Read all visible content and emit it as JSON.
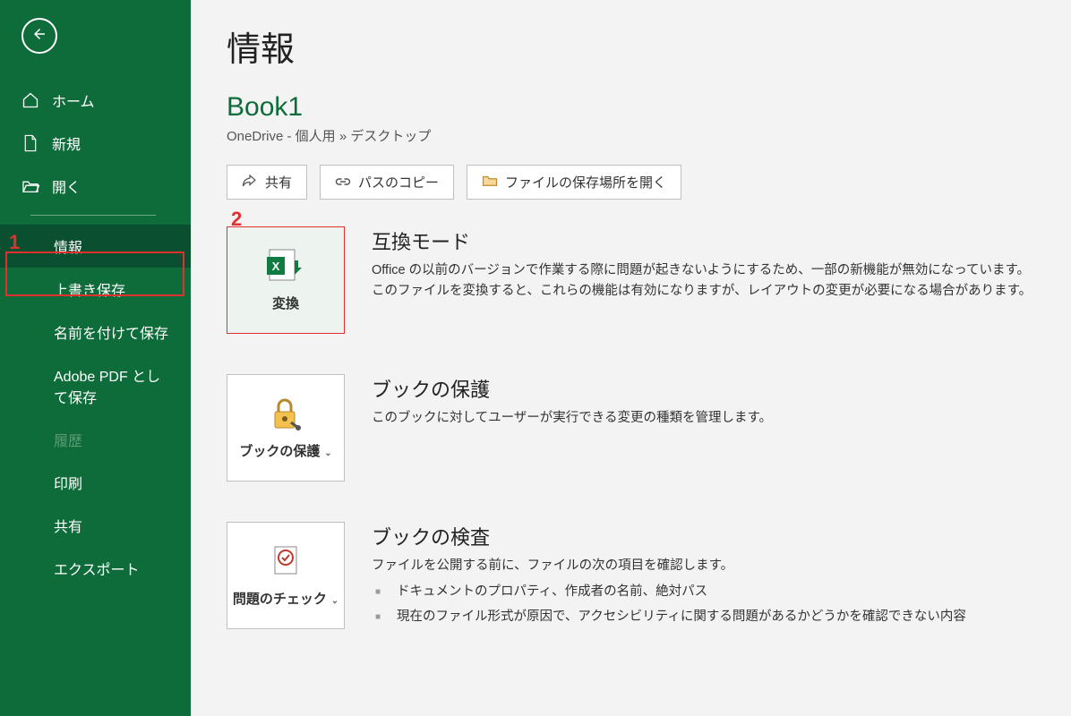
{
  "annotations": {
    "a1": "1",
    "a2": "2"
  },
  "sidebar": {
    "home": "ホーム",
    "new": "新規",
    "open": "開く",
    "info": "情報",
    "save": "上書き保存",
    "saveas": "名前を付けて保存",
    "adobepdf": "Adobe PDF として保存",
    "history": "履歴",
    "print": "印刷",
    "share": "共有",
    "export": "エクスポート"
  },
  "main": {
    "page_title": "情報",
    "doc_title": "Book1",
    "breadcrumb": "OneDrive - 個人用 » デスクトップ",
    "actions": {
      "share": "共有",
      "copy_path": "パスのコピー",
      "open_location": "ファイルの保存場所を開く"
    },
    "sections": {
      "compat": {
        "button_label": "変換",
        "title": "互換モード",
        "desc": "Office の以前のバージョンで作業する際に問題が起きないようにするため、一部の新機能が無効になっています。このファイルを変換すると、これらの機能は有効になりますが、レイアウトの変更が必要になる場合があります。"
      },
      "protect": {
        "button_label": "ブックの保護",
        "title": "ブックの保護",
        "desc": "このブックに対してユーザーが実行できる変更の種類を管理します。"
      },
      "inspect": {
        "button_label": "問題のチェック",
        "title": "ブックの検査",
        "desc": "ファイルを公開する前に、ファイルの次の項目を確認します。",
        "items": [
          "ドキュメントのプロパティ、作成者の名前、絶対パス",
          "現在のファイル形式が原因で、アクセシビリティに関する問題があるかどうかを確認できない内容"
        ]
      }
    }
  }
}
